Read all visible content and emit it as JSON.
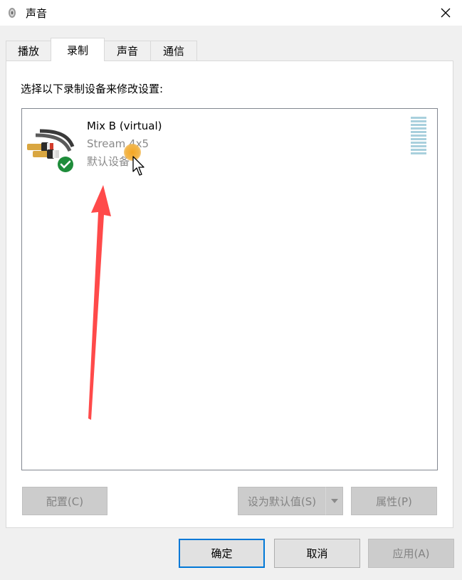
{
  "window": {
    "title": "声音",
    "close_glyph": "✕"
  },
  "tabs": [
    {
      "label": "播放",
      "active": false
    },
    {
      "label": "录制",
      "active": true
    },
    {
      "label": "声音",
      "active": false
    },
    {
      "label": "通信",
      "active": false
    }
  ],
  "instruction": "选择以下录制设备来修改设置:",
  "device": {
    "name": "Mix B (virtual)",
    "description": "Stream 4x5",
    "status": "默认设备",
    "icon": "rca-cable-icon",
    "badge_icon": "check-badge-icon"
  },
  "buttons": {
    "configure": "配置(C)",
    "set_default": "设为默认值(S)",
    "properties": "属性(P)",
    "ok": "确定",
    "cancel": "取消",
    "apply": "应用(A)"
  },
  "colors": {
    "accent": "#0078d7",
    "annotation_arrow": "#ff4a4a",
    "check_badge": "#1e8c3a"
  }
}
